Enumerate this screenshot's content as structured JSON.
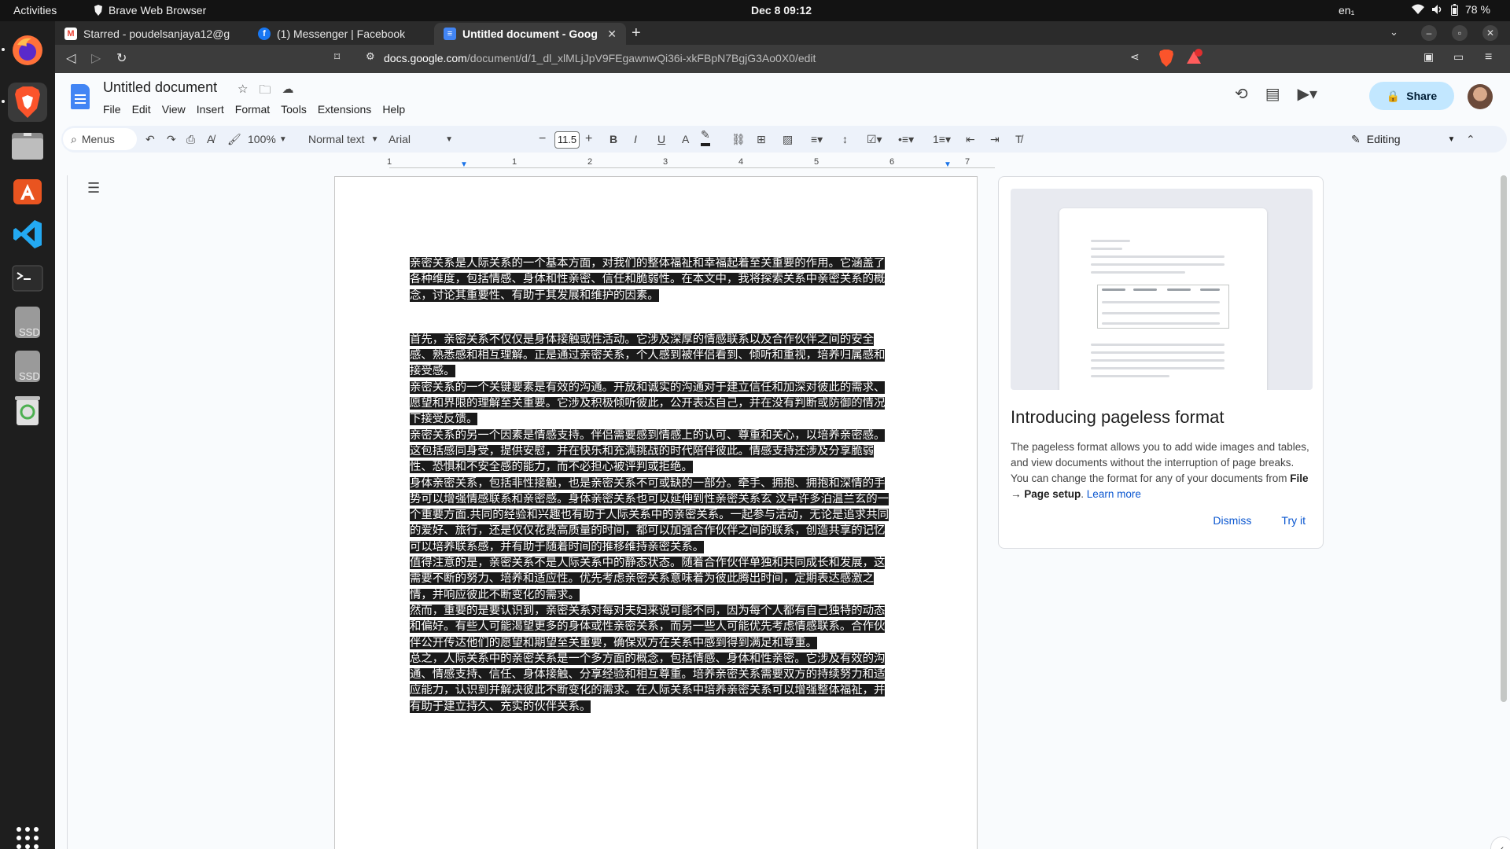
{
  "topbar": {
    "activities": "Activities",
    "app_name": "Brave Web Browser",
    "clock": "Dec 8  09:12",
    "language": "en₁",
    "battery": "78 %"
  },
  "dock": {
    "items": [
      {
        "name": "Firefox",
        "icon": "firefox-icon",
        "color": "#ff7139"
      },
      {
        "name": "Brave",
        "icon": "brave-icon",
        "color": "#fb542b"
      },
      {
        "name": "Files",
        "icon": "files-icon",
        "color": "#8a8a8a"
      },
      {
        "name": "Ubuntu Software",
        "icon": "software-store-icon",
        "color": "#e95420"
      },
      {
        "name": "Visual Studio Code",
        "icon": "vscode-icon",
        "color": "#23a9f2"
      },
      {
        "name": "Terminal",
        "icon": "terminal-icon",
        "color": "#2c2c2c"
      },
      {
        "name": "SSD",
        "icon": "drive-icon",
        "label": "SSD",
        "color": "#9a9a9a"
      },
      {
        "name": "SSD",
        "icon": "drive-icon",
        "label": "SSD",
        "color": "#9a9a9a"
      },
      {
        "name": "Trash",
        "icon": "trash-icon",
        "color": "#4caf50"
      },
      {
        "name": "Show Applications",
        "icon": "app-grid-icon",
        "color": "#ffffff"
      }
    ]
  },
  "browser": {
    "tabs": [
      {
        "label": "Starred - poudelsanjaya12@g",
        "favicon": "gmail-icon",
        "active": false
      },
      {
        "label": "(1) Messenger | Facebook",
        "favicon": "facebook-icon",
        "active": false
      },
      {
        "label": "Untitled document - Goog",
        "favicon": "docs-icon",
        "active": true
      }
    ],
    "url_domain": "docs.google.com",
    "url_path": "/document/d/1_dl_xlMLjJpV9FEgawnwQi36i-xkFBpN7BgjG3Ao0X0/edit",
    "brave_shield_badge": "",
    "rewards_badge": "1"
  },
  "docs": {
    "title": "Untitled document",
    "menu": [
      "File",
      "Edit",
      "View",
      "Insert",
      "Format",
      "Tools",
      "Extensions",
      "Help"
    ],
    "share_label": "Share",
    "toolbar": {
      "menus_search": "Menus",
      "zoom": "100%",
      "style": "Normal text",
      "font": "Arial",
      "font_size": "11.5",
      "mode": "Editing"
    },
    "ruler_numbers": [
      "1",
      "1",
      "2",
      "3",
      "4",
      "5",
      "6",
      "7"
    ],
    "paragraphs": [
      "亲密关系是人际关系的一个基本方面，对我们的整体福祉和幸福起着至关重要的作用。它涵盖了各种维度，包括情感、身体和性亲密、信任和脆弱性。在本文中，我将探索关系中亲密关系的概念，讨论其重要性、有助于其发展和维护的因素。",
      "首先，亲密关系不仅仅是身体接触或性活动。它涉及深厚的情感联系以及合作伙伴之间的安全感、熟悉感和相互理解。正是通过亲密关系，个人感到被伴侣看到、倾听和重视，培养归属感和接受感。",
      "亲密关系的一个关键要素是有效的沟通。开放和诚实的沟通对于建立信任和加深对彼此的需求、愿望和界限的理解至关重要。它涉及积极倾听彼此，公开表达自己，并在没有判断或防御的情况下接受反馈。",
      "亲密关系的另一个因素是情感支持。伴侣需要感到情感上的认可、尊重和关心，以培养亲密感。这包括感同身受，提供安慰，并在快乐和充满挑战的时代陪伴彼此。情感支持还涉及分享脆弱性、恐惧和不安全感的能力，而不必担心被评判或拒绝。",
      "身体亲密关系，包括非性接触，也是亲密关系不可或缺的一部分。牵手、拥抱、拥抱和深情的手势可以增强情感联系和亲密感。身体亲密关系也可以延伸到性亲密关系玄 汶早许多泊温兰玄的一个重要方面.共同的经验和兴趣也有助于人际关系中的亲密关系。一起参与活动，无论是追求共同的爱好、旅行，还是仅仅花费高质量的时间，都可以加强合作伙伴之间的联系，创造共享的记忆可以培养联系感，并有助于随着时间的推移维持亲密关系。",
      "值得注意的是，亲密关系不是人际关系中的静态状态。随着合作伙伴单独和共同成长和发展，这需要不断的努力、培养和适应性。优先考虑亲密关系意味着为彼此腾出时间，定期表达感激之情，并响应彼此不断变化的需求。",
      "然而，重要的是要认识到，亲密关系对每对夫妇来说可能不同，因为每个人都有自己独特的动态和偏好。有些人可能渴望更多的身体或性亲密关系，而另一些人可能优先考虑情感联系。合作伙伴公开传达他们的愿望和期望至关重要，确保双方在关系中感到得到满足和尊重。",
      "总之，人际关系中的亲密关系是一个多方面的概念，包括情感、身体和性亲密。它涉及有效的沟通、情感支持、信任、身体接触、分享经验和相互尊重。培养亲密关系需要双方的持续努力和适应能力，认识到并解决彼此不断变化的需求。在人际关系中培养亲密关系可以增强整体福祉，并有助于建立持久、充实的伙伴关系。"
    ],
    "pageless_card": {
      "title": "Introducing pageless format",
      "text_before": "The pageless format allows you to add wide images and tables, and view documents without the interruption of page breaks. You can change the format for any of your documents from ",
      "text_bold": "File → Page setup",
      "text_after": ". ",
      "learn_more": "Learn more",
      "dismiss": "Dismiss",
      "try_it": "Try it"
    }
  }
}
